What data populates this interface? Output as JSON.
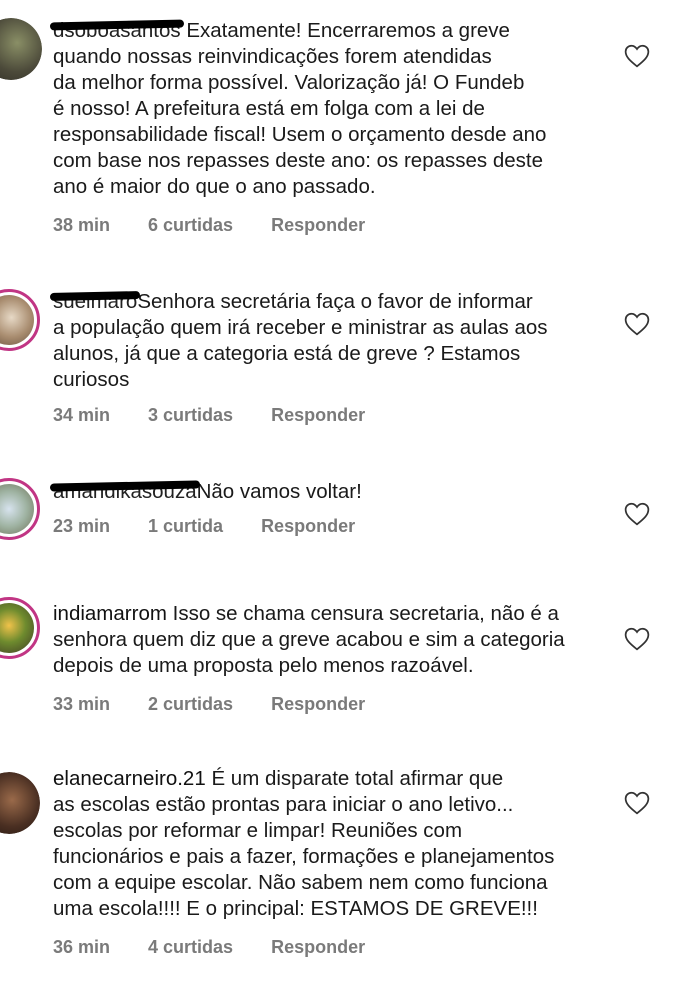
{
  "comments": [
    {
      "username": "dsoboasantos",
      "text": "Exatamente! Encerraremos a greve quando nossas reinvindicações forem atendidas da melhor forma possível. Valorização já! O Fundeb é nosso! A prefeitura está em folga com a lei de responsabilidade fiscal! Usem o orçamento desde ano com base nos repasses deste ano: os repasses deste ano é maior do que o ano passado.",
      "lines": [
        "Exatamente! Encerraremos a greve",
        "quando nossas reinvindicações forem atendidas",
        "da melhor forma possível. Valorização já! O Fundeb",
        "é nosso! A prefeitura está em folga com a lei de",
        "responsabilidade fiscal! Usem o orçamento desde ano",
        "com base nos repasses deste ano: os repasses deste",
        "ano é maior do que o ano passado."
      ],
      "time": "38 min",
      "likes": "6 curtidas",
      "reply": "Responder"
    },
    {
      "username": "sueimaro",
      "lines": [
        "Senhora secretária faça o favor de informar",
        "a população quem irá receber e ministrar as aulas aos",
        "alunos, já que a categoria está de greve ? Estamos",
        "curiosos"
      ],
      "time": "34 min",
      "likes": "3 curtidas",
      "reply": "Responder"
    },
    {
      "username": "amandikasouza",
      "lines": [
        "Não vamos voltar!"
      ],
      "time": "23 min",
      "likes": "1 curtida",
      "reply": "Responder"
    },
    {
      "username": "indiamarrom",
      "lines": [
        "Isso se chama censura secretaria, não é a",
        "senhora quem diz que a greve acabou e sim a categoria",
        "depois de uma proposta pelo menos razoável."
      ],
      "time": "33 min",
      "likes": "2 curtidas",
      "reply": "Responder"
    },
    {
      "username": "elanecarneiro.21",
      "lines": [
        "É um disparate total afirmar que",
        "as escolas estão prontas para iniciar o ano letivo...",
        "escolas por reformar e limpar! Reuniões com",
        "funcionários e pais a fazer, formações e planejamentos",
        "com a equipe escolar. Não sabem nem como funciona",
        "uma escola!!!! E o principal: ESTAMOS DE GREVE!!!"
      ],
      "time": "36 min",
      "likes": "4 curtidas",
      "reply": "Responder"
    }
  ],
  "icons": {
    "like": "heart-outline-icon"
  },
  "colors": {
    "meta": "#7a7a7a",
    "story_ring": "#c13584",
    "heart": "#333333"
  }
}
